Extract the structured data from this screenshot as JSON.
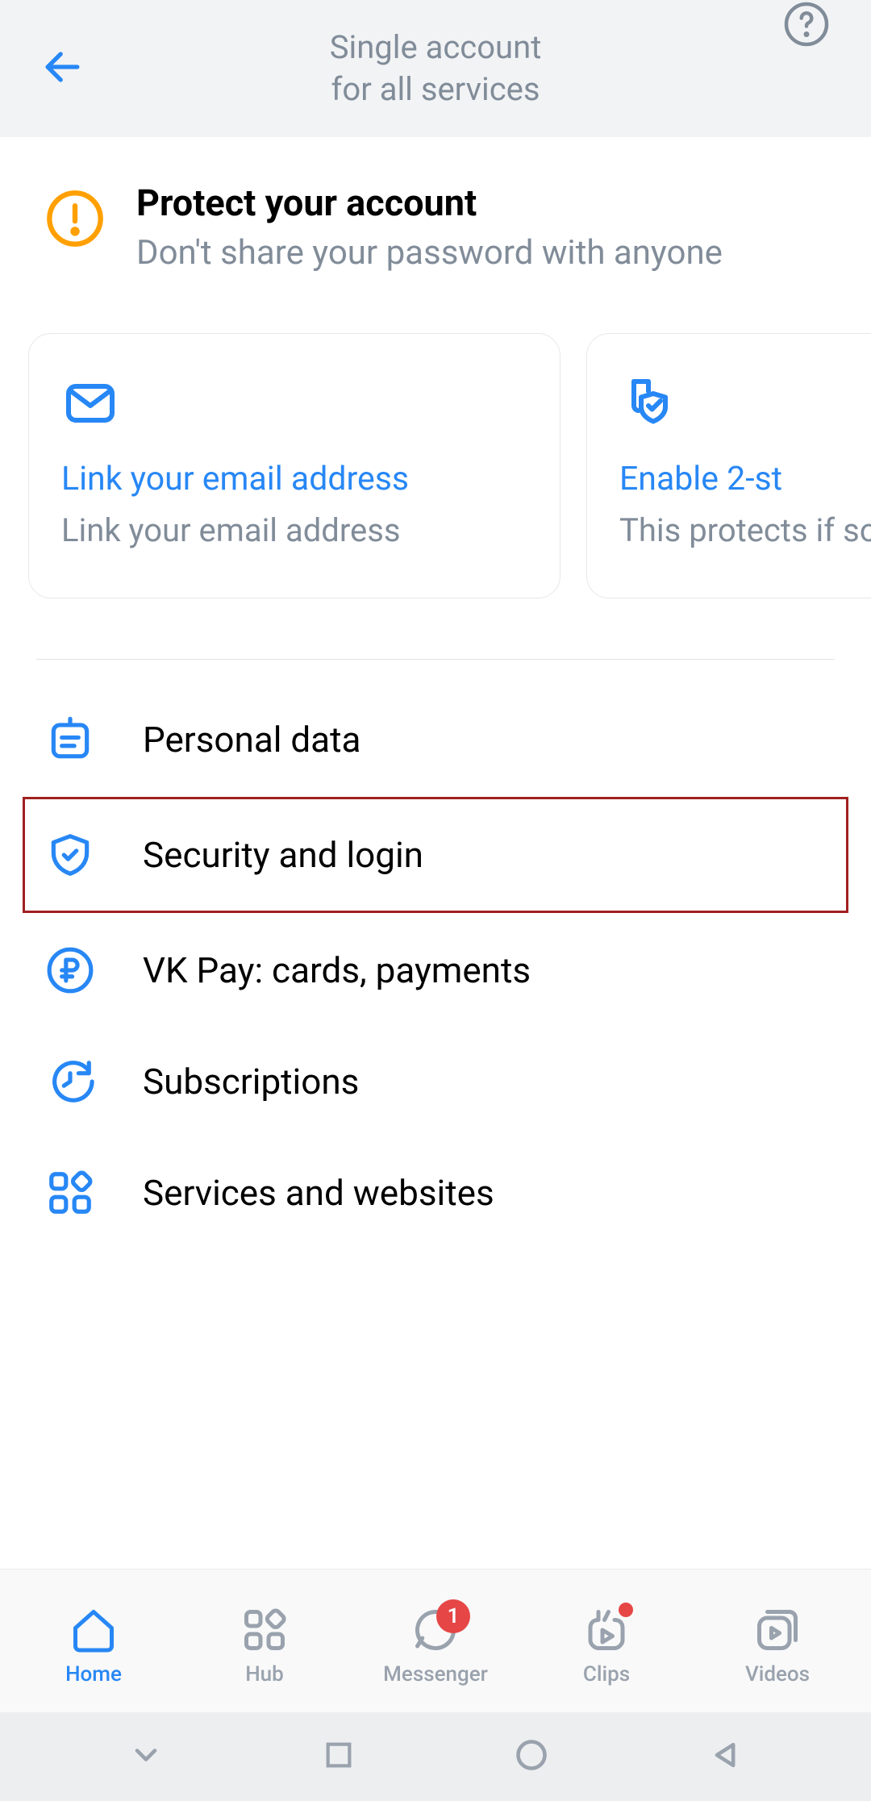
{
  "header": {
    "title_line1": "Single account",
    "title_line2": "for all services"
  },
  "protect": {
    "title": "Protect your account",
    "subtitle": "Don't share your password with anyone"
  },
  "cards": [
    {
      "title": "Link your email address",
      "subtitle": "Link your email address"
    },
    {
      "title": "Enable 2-st",
      "subtitle": "This protects if someone g your passwor"
    }
  ],
  "menu": [
    {
      "label": "Personal data",
      "icon": "id-card-icon"
    },
    {
      "label": "Security and login",
      "icon": "shield-check-icon"
    },
    {
      "label": "VK Pay: cards, payments",
      "icon": "ruble-circle-icon"
    },
    {
      "label": "Subscriptions",
      "icon": "clock-arrow-icon"
    },
    {
      "label": "Services and websites",
      "icon": "grid-icon"
    }
  ],
  "bottom_nav": {
    "home": "Home",
    "hub": "Hub",
    "messenger": "Messenger",
    "messenger_badge": "1",
    "clips": "Clips",
    "videos": "Videos"
  }
}
